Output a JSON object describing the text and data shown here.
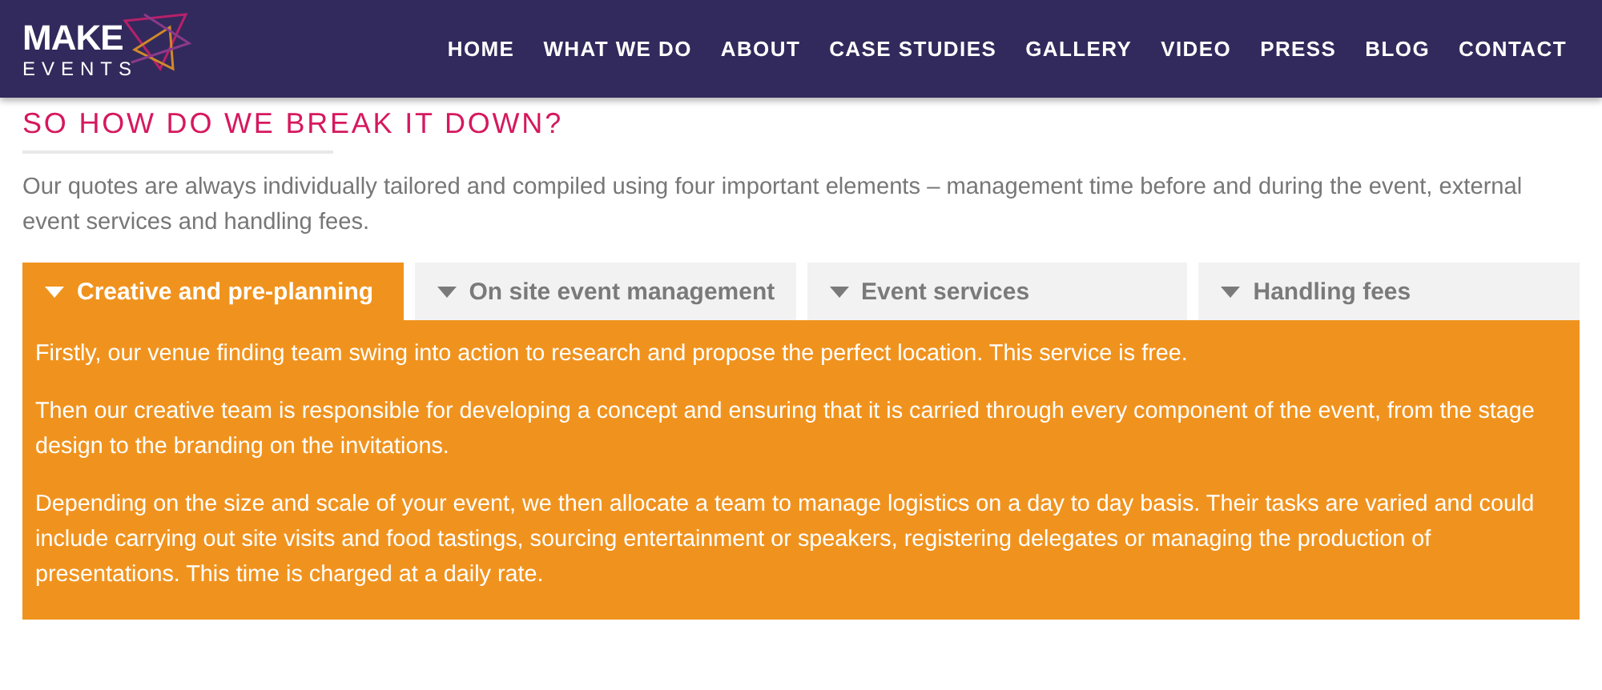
{
  "header": {
    "logo": {
      "line_1": "MAKE",
      "line_2": "EVENTS"
    },
    "nav": [
      {
        "label": "HOME"
      },
      {
        "label": "WHAT WE DO"
      },
      {
        "label": "ABOUT"
      },
      {
        "label": "CASE STUDIES"
      },
      {
        "label": "GALLERY"
      },
      {
        "label": "VIDEO"
      },
      {
        "label": "PRESS"
      },
      {
        "label": "BLOG"
      },
      {
        "label": "CONTACT"
      }
    ]
  },
  "section": {
    "heading": "SO HOW DO WE BREAK IT DOWN?",
    "intro": "Our quotes are always individually tailored and compiled using four important elements – management time before and during the event, external event services and handling fees."
  },
  "tabs": [
    {
      "label": "Creative and pre-planning",
      "selected": true
    },
    {
      "label": "On site event management",
      "selected": false
    },
    {
      "label": "Event services",
      "selected": false
    },
    {
      "label": "Handling fees",
      "selected": false
    }
  ],
  "panel": {
    "paragraphs": [
      "Firstly, our venue finding team swing into action to research and propose the perfect location. This service is free.",
      "Then our creative team is responsible for developing a concept and ensuring that it is carried through every component of the event, from the stage design to the branding on the invitations.",
      "Depending on the size and scale of your event, we then allocate a team to manage logistics on a day to day basis. Their tasks are varied and could include carrying out site visits and food tastings, sourcing entertainment or speakers, registering delegates or managing the production of presentations. This time is charged at a daily rate."
    ]
  }
}
